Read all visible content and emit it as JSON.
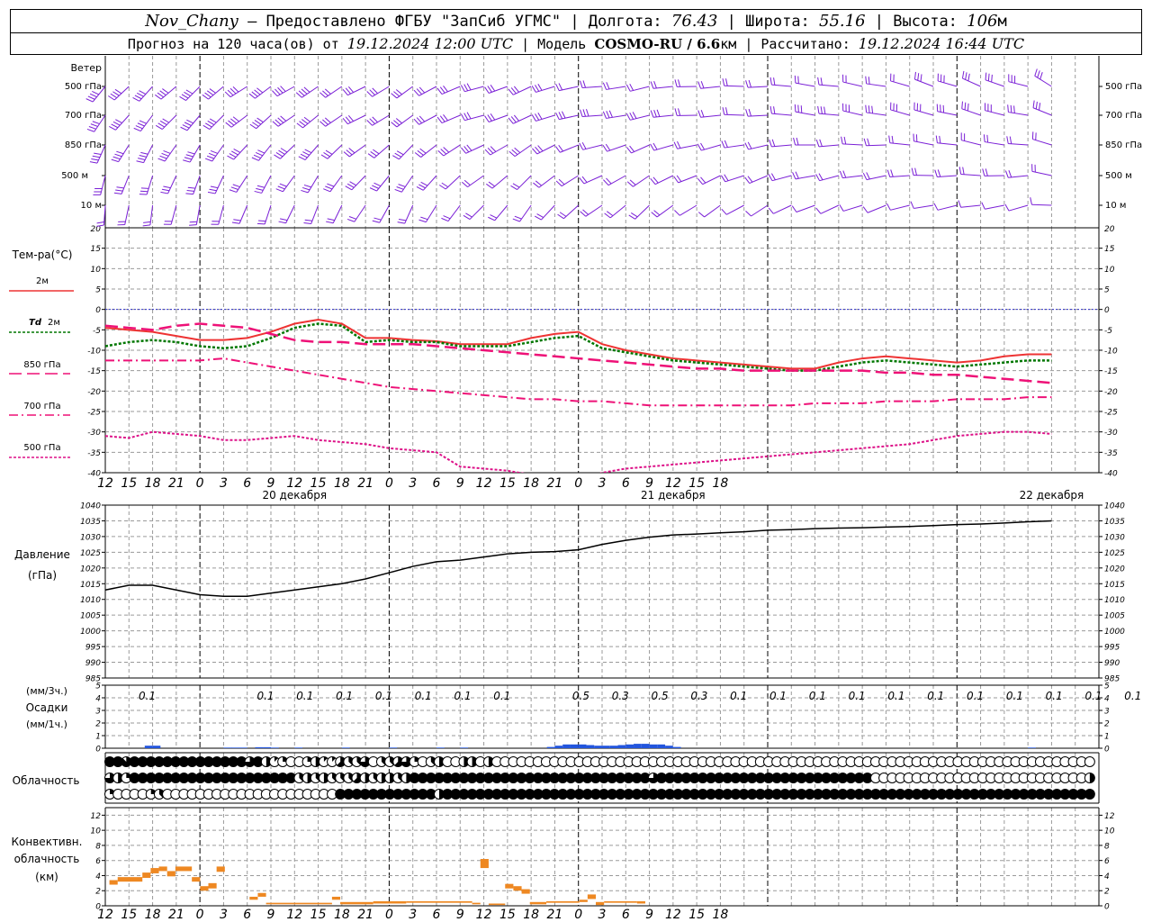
{
  "header": {
    "station": "Nov_Chany",
    "provider": " — Предоставлено ФГБУ \"ЗапСиб УГМС\" | Долгота: ",
    "lon": "76.43",
    "lat_label": " | Широта: ",
    "lat": "55.16",
    "alt_label": " | Высота: ",
    "alt": "106",
    "alt_unit": "м",
    "forecast_label": "Прогноз на 120 часа(ов) от ",
    "forecast_date": "19.12.2024 12:00 UTC",
    "model_label": "  | Модель ",
    "model": "COSMO-RU / 6.6",
    "model_unit": "км",
    "calc_label": " | Рассчитано: ",
    "calc_date": "19.12.2024 16:44 UTC"
  },
  "colors": {
    "t2m": "#ee3333",
    "td2m": "#007700",
    "t850": "#ee1177",
    "t700": "#ee1177",
    "t500": "#dd1188",
    "wind": "#7a1fd6",
    "precip": "#2255dd",
    "conv": "#ee8822",
    "zero": "#3333cc"
  },
  "chart_data": [
    {
      "type": "barbs",
      "title": "Ветер",
      "levels": [
        "500 гПа",
        "700 гПа",
        "850 гПа",
        "500 м",
        "10 м"
      ],
      "note": "wind barbs every 3 h, 12 UTC 19.12 – 18 UTC 24.12"
    },
    {
      "type": "line",
      "title": "Тем-ра(°C)",
      "ylim": [
        -40,
        20
      ],
      "yticks": [
        20,
        15,
        10,
        5,
        0,
        -5,
        -10,
        -15,
        -20,
        -25,
        -30,
        -35,
        -40
      ],
      "x_hours": [
        0,
        3,
        6,
        9,
        12,
        15,
        18,
        21,
        24,
        27,
        30,
        33,
        36,
        39,
        42,
        45,
        48,
        51,
        54,
        57,
        60,
        63,
        66,
        69,
        72,
        75,
        78,
        81,
        84,
        87,
        90,
        93,
        96,
        99,
        102,
        105,
        108,
        111,
        114,
        117,
        120
      ],
      "series": [
        {
          "name": "2м",
          "values": [
            -4.5,
            -5,
            -5.5,
            -6.5,
            -7.5,
            -7.5,
            -7,
            -5.5,
            -3.5,
            -2.5,
            -3.5,
            -7,
            -7,
            -7.5,
            -7.8,
            -8.5,
            -8.5,
            -8.5,
            -7,
            -6,
            -5.5,
            -8.5,
            -10,
            -11,
            -12,
            -12.5,
            -13,
            -13.5,
            -14,
            -14.5,
            -14.5,
            -13,
            -12,
            -11.5,
            -12,
            -12.5,
            -13,
            -12.5,
            -11.5,
            -11,
            -11
          ]
        },
        {
          "name": "Td 2м",
          "values": [
            -9,
            -8,
            -7.5,
            -8,
            -9,
            -9.5,
            -9,
            -7,
            -4.5,
            -3.5,
            -4,
            -8,
            -7.5,
            -8,
            -8,
            -9,
            -9,
            -9,
            -8,
            -7,
            -6.5,
            -9.5,
            -10.5,
            -11.5,
            -12.5,
            -13,
            -13.5,
            -14,
            -14.5,
            -15,
            -15,
            -14,
            -13,
            -12.5,
            -13,
            -13.5,
            -14,
            -13.5,
            -13,
            -12.5,
            -12.5
          ]
        },
        {
          "name": "850 гПа",
          "values": [
            -4,
            -4.5,
            -5,
            -4,
            -3.5,
            -4,
            -4.5,
            -6,
            -7.5,
            -8,
            -8,
            -8.5,
            -8.5,
            -8.5,
            -9,
            -9.5,
            -10,
            -10.5,
            -11,
            -11.5,
            -12,
            -12.5,
            -13,
            -13.5,
            -14,
            -14.5,
            -14.5,
            -15,
            -15,
            -15,
            -15,
            -15,
            -15,
            -15.5,
            -15.5,
            -16,
            -16,
            -16.5,
            -17,
            -17.5,
            -18
          ]
        },
        {
          "name": "700 гПа",
          "values": [
            -12.5,
            -12.5,
            -12.5,
            -12.5,
            -12.5,
            -12,
            -13,
            -14,
            -15,
            -16,
            -17,
            -18,
            -19,
            -19.5,
            -20,
            -20.5,
            -21,
            -21.5,
            -22,
            -22,
            -22.5,
            -22.5,
            -23,
            -23.5,
            -23.5,
            -23.5,
            -23.5,
            -23.5,
            -23.5,
            -23.5,
            -23,
            -23,
            -23,
            -22.5,
            -22.5,
            -22.5,
            -22,
            -22,
            -22,
            -21.5,
            -21.5
          ]
        },
        {
          "name": "500 гПа",
          "values": [
            -31,
            -31.5,
            -30,
            -30.5,
            -31,
            -32,
            -32,
            -31.5,
            -31,
            -32,
            -32.5,
            -33,
            -34,
            -34.5,
            -35,
            -38.5,
            -39,
            -39.5,
            -40.5,
            -42,
            -42.5,
            -40,
            -39,
            -38.5,
            -38,
            -37.5,
            -37,
            -36.5,
            -36,
            -35.5,
            -35,
            -34.5,
            -34,
            -33.5,
            -33,
            -32,
            -31,
            -30.5,
            -30,
            -30,
            -30.5
          ]
        }
      ]
    },
    {
      "type": "line",
      "title": "Давление",
      "ylabel": "(гПа)",
      "ylim": [
        985,
        1040
      ],
      "yticks": [
        1040,
        1035,
        1030,
        1025,
        1020,
        1015,
        1010,
        1005,
        1000,
        995,
        990,
        985
      ],
      "x_hours": [
        0,
        3,
        6,
        9,
        12,
        15,
        18,
        21,
        24,
        27,
        30,
        33,
        36,
        39,
        42,
        45,
        48,
        51,
        54,
        57,
        60,
        63,
        66,
        69,
        72,
        75,
        78,
        81,
        84,
        87,
        90,
        93,
        96,
        99,
        102,
        105,
        108,
        111,
        114,
        117,
        120
      ],
      "series": [
        {
          "name": "",
          "values": [
            1013,
            1014.5,
            1014.5,
            1013,
            1011.5,
            1011,
            1011,
            1012,
            1013,
            1014,
            1015,
            1016.5,
            1018.5,
            1020.5,
            1022,
            1022.5,
            1023.5,
            1024.5,
            1025,
            1025.2,
            1025.8,
            1027.5,
            1028.8,
            1029.8,
            1030.5,
            1030.8,
            1031.2,
            1031.5,
            1032,
            1032.2,
            1032.5,
            1032.7,
            1032.8,
            1033,
            1033.2,
            1033.5,
            1033.8,
            1034,
            1034.3,
            1034.7,
            1035
          ]
        }
      ]
    },
    {
      "type": "bar",
      "title": "Осадки",
      "ylabel_top": "(мм/3ч.)",
      "ylabel_bottom": "(мм/1ч.)",
      "ylim": [
        0,
        5
      ],
      "yticks": [
        5,
        4,
        3,
        2,
        1,
        0
      ],
      "labels_3h": [
        "0.1",
        "",
        "",
        "0.1",
        "0.1",
        "0.1",
        "0.1",
        "0.1",
        "0.1",
        "0.1",
        "",
        "0.5",
        "0.3",
        "0.5",
        "0.3",
        "0.1",
        "0.1",
        "0.1",
        "0.1",
        "0.1",
        "0.1",
        "0.1",
        "0.1",
        "0.1",
        "0.1",
        "0.1"
      ],
      "hourly_nonzero": [
        [
          5,
          0.2
        ],
        [
          6,
          0.2
        ],
        [
          15,
          0.05
        ],
        [
          16,
          0.05
        ],
        [
          17,
          0.05
        ],
        [
          19,
          0.08
        ],
        [
          20,
          0.08
        ],
        [
          21,
          0.05
        ],
        [
          24,
          0.05
        ],
        [
          30,
          0.05
        ],
        [
          36,
          0.05
        ],
        [
          42,
          0.05
        ],
        [
          45,
          0.05
        ],
        [
          56,
          0.1
        ],
        [
          57,
          0.2
        ],
        [
          58,
          0.3
        ],
        [
          59,
          0.3
        ],
        [
          60,
          0.3
        ],
        [
          61,
          0.25
        ],
        [
          62,
          0.2
        ],
        [
          63,
          0.2
        ],
        [
          64,
          0.2
        ],
        [
          65,
          0.25
        ],
        [
          66,
          0.3
        ],
        [
          67,
          0.35
        ],
        [
          68,
          0.35
        ],
        [
          69,
          0.3
        ],
        [
          70,
          0.3
        ],
        [
          71,
          0.2
        ],
        [
          72,
          0.1
        ],
        [
          117,
          0.05
        ]
      ]
    },
    {
      "type": "table",
      "title": "Облачность",
      "row_names": [
        "upper",
        "middle",
        "lower"
      ],
      "note": "hourly cloud-cover circles: 0=clear, 8=overcast (octas)",
      "upper": [
        8,
        8,
        7,
        8,
        8,
        8,
        8,
        8,
        8,
        8,
        8,
        8,
        8,
        8,
        8,
        8,
        8,
        6,
        8,
        4,
        1,
        2,
        0,
        0,
        2,
        4,
        1,
        1,
        5,
        3,
        3,
        6,
        0,
        3,
        3,
        5,
        6,
        2,
        0,
        3,
        4,
        0,
        0,
        4,
        4,
        0,
        4,
        0,
        0,
        0,
        0,
        0,
        0,
        0,
        0,
        0,
        0,
        0,
        0,
        0,
        0,
        0,
        0,
        0,
        0,
        0,
        0,
        0,
        0,
        0,
        0,
        0,
        0,
        0,
        0,
        0,
        0,
        0,
        0,
        0,
        0,
        0,
        0,
        0,
        0,
        0,
        0,
        0,
        0,
        0,
        0,
        0,
        0,
        0,
        0,
        0,
        0,
        0,
        0,
        0,
        0,
        0,
        0,
        0,
        0,
        0,
        0,
        0,
        0,
        0,
        0,
        0,
        0,
        0,
        0,
        0,
        0,
        0,
        0,
        0,
        4
      ],
      "middle": [
        6,
        4,
        2,
        8,
        8,
        8,
        8,
        8,
        8,
        8,
        8,
        8,
        8,
        8,
        8,
        8,
        8,
        8,
        8,
        8,
        8,
        8,
        8,
        3,
        4,
        3,
        4,
        3,
        3,
        3,
        5,
        4,
        3,
        4,
        4,
        3,
        4,
        8,
        8,
        8,
        8,
        8,
        8,
        8,
        8,
        8,
        8,
        8,
        8,
        8,
        8,
        8,
        8,
        8,
        8,
        8,
        8,
        8,
        8,
        8,
        8,
        8,
        8,
        8,
        8,
        8,
        6,
        8,
        8,
        8,
        8,
        8,
        8,
        8,
        8,
        8,
        8,
        8,
        8,
        8,
        8,
        8,
        8,
        8,
        8,
        8,
        8,
        8,
        8,
        8,
        8,
        8,
        8,
        0,
        0,
        0,
        0,
        0,
        0,
        0,
        0,
        0,
        0,
        0,
        0,
        0,
        0,
        0,
        0,
        0,
        0,
        0,
        0,
        0,
        0,
        0,
        0,
        0,
        0,
        4,
        7
      ],
      "lower": [
        2,
        0,
        0,
        0,
        0,
        2,
        3,
        0,
        0,
        0,
        0,
        0,
        0,
        0,
        0,
        0,
        0,
        0,
        0,
        0,
        0,
        0,
        0,
        0,
        0,
        0,
        0,
        0,
        8,
        8,
        8,
        8,
        8,
        8,
        8,
        8,
        8,
        8,
        8,
        8,
        4,
        8,
        8,
        8,
        8,
        8,
        8,
        8,
        8,
        8,
        8,
        8,
        8,
        8,
        8,
        8,
        8,
        8,
        8,
        8,
        8,
        8,
        8,
        8,
        8,
        8,
        8,
        8,
        8,
        8,
        8,
        8,
        8,
        8,
        8,
        8,
        8,
        8,
        8,
        8,
        8,
        8,
        8,
        8,
        8,
        8,
        8,
        8,
        8,
        8,
        8,
        8,
        8,
        8,
        8,
        8,
        8,
        8,
        8,
        8,
        8,
        8,
        8,
        8,
        8,
        8,
        8,
        8,
        8,
        8,
        8,
        8,
        8,
        8,
        8,
        8,
        8,
        8,
        8,
        8,
        8
      ]
    },
    {
      "type": "bar",
      "title": "Конвективн.",
      "subtitle": "облачность",
      "ylabel": "(км)",
      "ylim": [
        0,
        13
      ],
      "yticks": [
        12,
        10,
        8,
        6,
        4,
        2,
        0
      ],
      "segments": [
        [
          1,
          3,
          2.8,
          3.4
        ],
        [
          3,
          9,
          3.2,
          3.8
        ],
        [
          9,
          11,
          3.7,
          4.4
        ],
        [
          11,
          13,
          4.3,
          5.0
        ],
        [
          13,
          15,
          4.6,
          5.2
        ],
        [
          15,
          17,
          3.9,
          4.6
        ],
        [
          17,
          21,
          4.6,
          5.2
        ],
        [
          21,
          23,
          3.2,
          3.8
        ],
        [
          23,
          25,
          2.0,
          2.6
        ],
        [
          25,
          27,
          2.3,
          3.0
        ],
        [
          27,
          29,
          4.5,
          5.2
        ],
        [
          35,
          37,
          0.8,
          1.2
        ],
        [
          37,
          39,
          1.2,
          1.7
        ],
        [
          39,
          55,
          0.2,
          0.4
        ],
        [
          55,
          57,
          0.8,
          1.2
        ],
        [
          57,
          65,
          0.2,
          0.5
        ],
        [
          65,
          73,
          0.3,
          0.6
        ],
        [
          73,
          89,
          0.4,
          0.6
        ],
        [
          89,
          91,
          0.2,
          0.4
        ],
        [
          91,
          93,
          5.0,
          6.2
        ],
        [
          93,
          97,
          0.1,
          0.3
        ],
        [
          97,
          99,
          2.3,
          2.9
        ],
        [
          99,
          101,
          2.0,
          2.6
        ],
        [
          101,
          103,
          1.6,
          2.2
        ],
        [
          103,
          107,
          0.2,
          0.5
        ],
        [
          107,
          115,
          0.4,
          0.6
        ],
        [
          115,
          117,
          0.5,
          0.8
        ],
        [
          117,
          119,
          0.9,
          1.5
        ],
        [
          119,
          121,
          0.1,
          0.5
        ],
        [
          121,
          129,
          0.4,
          0.6
        ],
        [
          129,
          131,
          0.3,
          0.6
        ]
      ]
    }
  ],
  "time_axis": {
    "hours_labels": [
      "12",
      "15",
      "18",
      "21",
      "0",
      "3",
      "6",
      "9",
      "12",
      "15",
      "18",
      "21",
      "0",
      "3",
      "6",
      "9",
      "12",
      "15",
      "18",
      "21",
      "0",
      "3",
      "6",
      "9",
      "12",
      "15",
      "18"
    ],
    "dates": [
      "20 декабря",
      "21 декабря",
      "22 декабря"
    ]
  },
  "legend": {
    "t2m": "2м",
    "td2m_prefix": "Td",
    "td2m": "2м",
    "t850": "850 гПа",
    "t700": "700 гПа",
    "t500": "500 гПа"
  },
  "labels": {
    "wind": "Ветер",
    "wind_levels": [
      "500 гПа",
      "700 гПа",
      "850 гПа",
      "500 м",
      "10  м"
    ],
    "temp": "Тем-ра(°C)",
    "pressure": "Давление",
    "pressure_unit": "(гПа)",
    "precip_unit_top": "(мм/3ч.)",
    "precip": "Осадки",
    "precip_unit_bottom": "(мм/1ч.)",
    "clouds": "Облачность",
    "conv1": "Конвективн.",
    "conv2": "облачность",
    "conv_unit": "(км)"
  }
}
